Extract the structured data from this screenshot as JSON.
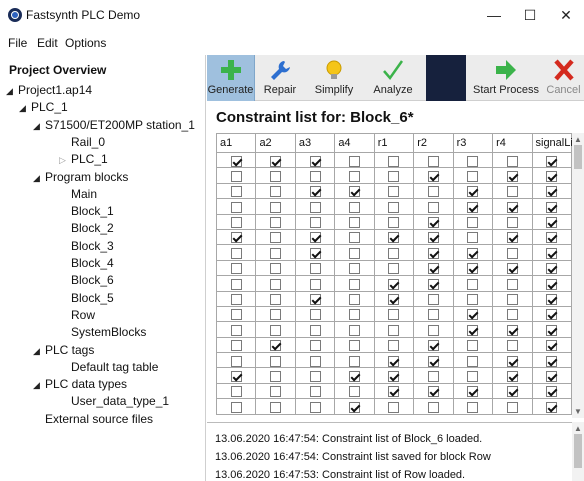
{
  "window": {
    "title": "Fastsynth PLC Demo",
    "minimize": "—",
    "maximize": "☐",
    "close": "✕"
  },
  "menu": [
    "File",
    "Edit",
    "Options"
  ],
  "tree": {
    "heading": "Project Overview",
    "nodes": [
      {
        "label": "Project1.ap14",
        "level": 1,
        "toggle": "expanded"
      },
      {
        "label": "PLC_1",
        "level": 2,
        "toggle": "expanded"
      },
      {
        "label": "S71500/ET200MP station_1",
        "level": 3,
        "toggle": "expanded"
      },
      {
        "label": "Rail_0",
        "level": 4,
        "toggle": "none"
      },
      {
        "label": "PLC_1",
        "level": 4,
        "toggle": "collapsed"
      },
      {
        "label": "Program blocks",
        "level": 3,
        "toggle": "expanded"
      },
      {
        "label": "Main",
        "level": 4,
        "toggle": "none"
      },
      {
        "label": "Block_1",
        "level": 4,
        "toggle": "none"
      },
      {
        "label": "Block_2",
        "level": 4,
        "toggle": "none"
      },
      {
        "label": "Block_3",
        "level": 4,
        "toggle": "none"
      },
      {
        "label": "Block_4",
        "level": 4,
        "toggle": "none"
      },
      {
        "label": "Block_6",
        "level": 4,
        "toggle": "none"
      },
      {
        "label": "Block_5",
        "level": 4,
        "toggle": "none"
      },
      {
        "label": "Row",
        "level": 4,
        "toggle": "none"
      },
      {
        "label": "SystemBlocks",
        "level": 4,
        "toggle": "none"
      },
      {
        "label": "PLC tags",
        "level": 3,
        "toggle": "expanded"
      },
      {
        "label": "Default tag table",
        "level": 4,
        "toggle": "none"
      },
      {
        "label": "PLC data types",
        "level": 3,
        "toggle": "expanded"
      },
      {
        "label": "User_data_type_1",
        "level": 4,
        "toggle": "none"
      },
      {
        "label": "External source files",
        "level": 3,
        "toggle": "none"
      }
    ]
  },
  "toolbar": {
    "generate": "Generate",
    "repair": "Repair",
    "simplify": "Simplify",
    "analyze": "Analyze",
    "start_process": "Start Process",
    "cancel": "Cancel",
    "active": "Generate",
    "colors": {
      "active_bg": "#9fc0de",
      "dark_block": "#16213d",
      "green": "#3bb34a",
      "blue": "#2d6fd0",
      "yellow": "#f5c518",
      "red": "#d42a1e"
    }
  },
  "constraint_title": "Constraint list for: Block_6*",
  "grid": {
    "columns": [
      "a1",
      "a2",
      "a3",
      "a4",
      "r1",
      "r2",
      "r3",
      "r4",
      "signalLi"
    ],
    "rows": [
      [
        1,
        1,
        1,
        0,
        0,
        0,
        0,
        0,
        1
      ],
      [
        0,
        0,
        0,
        0,
        0,
        1,
        0,
        1,
        1
      ],
      [
        0,
        0,
        1,
        1,
        0,
        0,
        1,
        0,
        1
      ],
      [
        0,
        0,
        0,
        0,
        0,
        0,
        1,
        1,
        1
      ],
      [
        0,
        0,
        0,
        0,
        0,
        1,
        0,
        0,
        1
      ],
      [
        1,
        0,
        1,
        0,
        1,
        1,
        0,
        1,
        1
      ],
      [
        0,
        0,
        1,
        0,
        0,
        1,
        1,
        0,
        1
      ],
      [
        0,
        0,
        0,
        0,
        0,
        1,
        1,
        1,
        1
      ],
      [
        0,
        0,
        0,
        0,
        1,
        1,
        0,
        0,
        1
      ],
      [
        0,
        0,
        1,
        0,
        1,
        0,
        0,
        0,
        1
      ],
      [
        0,
        0,
        0,
        0,
        0,
        0,
        1,
        0,
        1
      ],
      [
        0,
        0,
        0,
        0,
        0,
        0,
        1,
        1,
        1
      ],
      [
        0,
        1,
        0,
        0,
        0,
        1,
        0,
        0,
        1
      ],
      [
        0,
        0,
        0,
        0,
        1,
        1,
        0,
        1,
        1
      ],
      [
        1,
        0,
        0,
        1,
        1,
        0,
        0,
        1,
        1
      ],
      [
        0,
        0,
        0,
        0,
        1,
        1,
        1,
        1,
        1
      ],
      [
        0,
        0,
        0,
        1,
        0,
        0,
        0,
        0,
        1
      ]
    ]
  },
  "log": [
    "13.06.2020 16:47:54: Constraint list of Block_6 loaded.",
    "13.06.2020 16:47:54: Constraint list saved for block Row",
    "13.06.2020 16:47:53: Constraint list of Row loaded."
  ]
}
